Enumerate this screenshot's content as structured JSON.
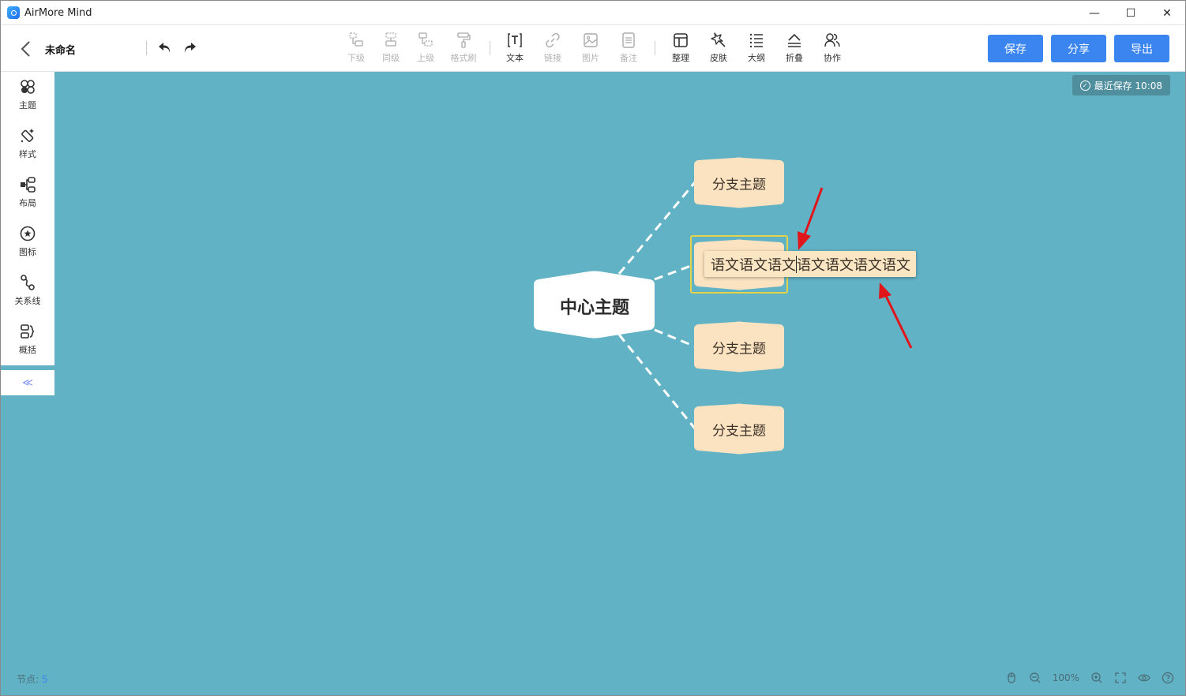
{
  "window": {
    "app_title": "AirMore Mind",
    "controls": {
      "minimize": "—",
      "maximize": "☐",
      "close": "✕"
    }
  },
  "toolbar": {
    "doc_name": "未命名",
    "tools_left": [
      {
        "label": "下级",
        "icon": "add-child-icon",
        "enabled": false
      },
      {
        "label": "同级",
        "icon": "add-sibling-icon",
        "enabled": false
      },
      {
        "label": "上级",
        "icon": "add-parent-icon",
        "enabled": false
      },
      {
        "label": "格式刷",
        "icon": "format-painter-icon",
        "enabled": false
      }
    ],
    "tools_mid": [
      {
        "label": "文本",
        "icon": "text-icon",
        "enabled": true
      },
      {
        "label": "链接",
        "icon": "link-icon",
        "enabled": false
      },
      {
        "label": "图片",
        "icon": "image-icon",
        "enabled": false
      },
      {
        "label": "备注",
        "icon": "note-icon",
        "enabled": false
      }
    ],
    "tools_right": [
      {
        "label": "整理",
        "icon": "arrange-icon",
        "enabled": true
      },
      {
        "label": "皮肤",
        "icon": "skin-icon",
        "enabled": true
      },
      {
        "label": "大纲",
        "icon": "outline-icon",
        "enabled": true
      },
      {
        "label": "折叠",
        "icon": "collapse-icon",
        "enabled": true
      },
      {
        "label": "协作",
        "icon": "collaborate-icon",
        "enabled": true
      }
    ],
    "save_label": "保存",
    "share_label": "分享",
    "export_label": "导出",
    "accent_color": "#3a85f0"
  },
  "canvas": {
    "background": "#62b2c6",
    "save_status": "最近保存 10:08",
    "side_panel": [
      {
        "label": "主题",
        "icon": "theme-icon"
      },
      {
        "label": "样式",
        "icon": "style-icon"
      },
      {
        "label": "布局",
        "icon": "layout-icon"
      },
      {
        "label": "图标",
        "icon": "sticker-icon"
      },
      {
        "label": "关系线",
        "icon": "relation-icon"
      },
      {
        "label": "概括",
        "icon": "summary-icon"
      }
    ],
    "collapse_label": "≪",
    "mindmap": {
      "center": "中心主题",
      "branches": [
        "分支主题",
        "分支主题",
        "分支主题",
        "分支主题"
      ],
      "editing_text_before_caret": "语文语文语文",
      "editing_text_after_caret": "语文语文语文语文"
    },
    "node_count_label": "节点:",
    "node_count": "5",
    "zoom_level": "100%"
  }
}
